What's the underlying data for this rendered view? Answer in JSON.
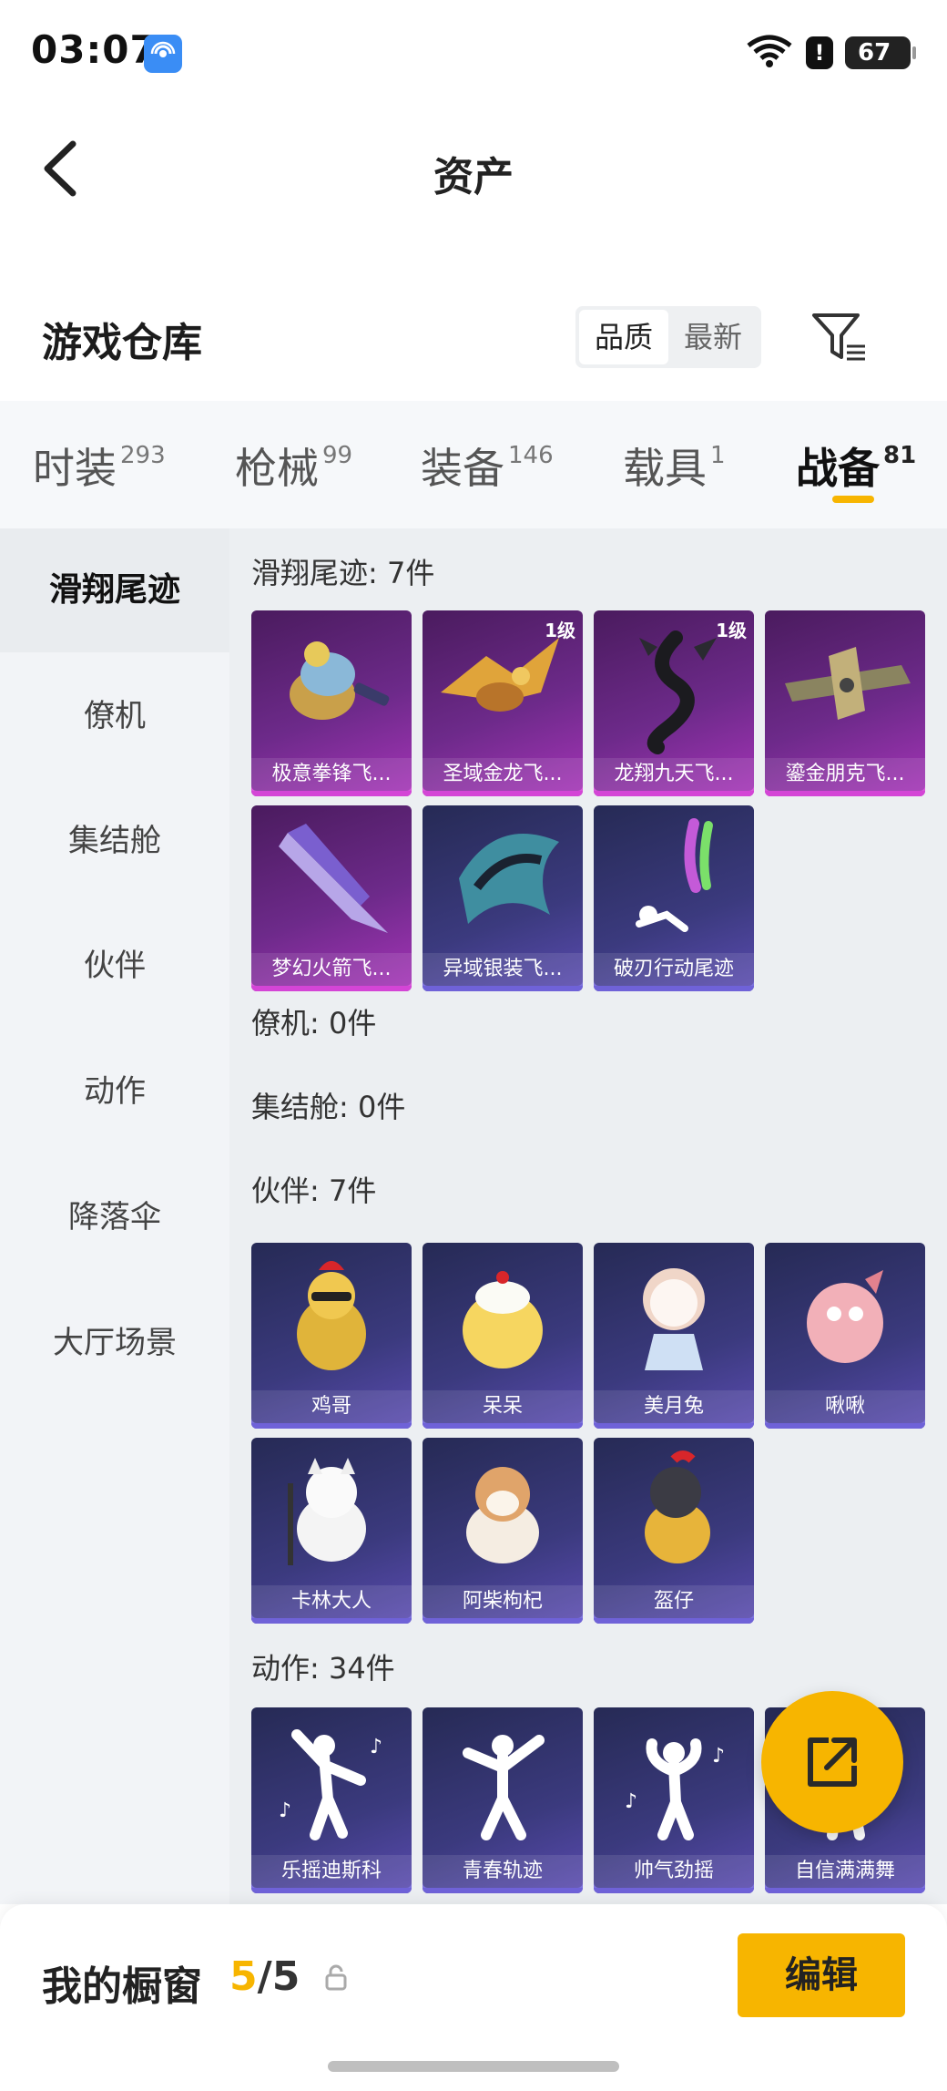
{
  "status_bar": {
    "time": "03:07",
    "alert": "!",
    "battery": "67"
  },
  "header": {
    "title": "资产"
  },
  "warehouse": {
    "title": "游戏仓库",
    "sort_options": [
      "品质",
      "最新"
    ]
  },
  "tabs": [
    {
      "label": "时装",
      "count": "293"
    },
    {
      "label": "枪械",
      "count": "99"
    },
    {
      "label": "装备",
      "count": "146"
    },
    {
      "label": "载具",
      "count": "1"
    },
    {
      "label": "战备",
      "count": "81"
    }
  ],
  "sidebar": {
    "items": [
      "滑翔尾迹",
      "僚机",
      "集结舱",
      "伙伴",
      "动作",
      "降落伞",
      "大厅场景"
    ]
  },
  "sections": {
    "glide": {
      "title": "滑翔尾迹: 7件",
      "items": [
        {
          "name": "极意拳锋飞...",
          "level": ""
        },
        {
          "name": "圣域金龙飞...",
          "level": "1级"
        },
        {
          "name": "龙翔九天飞...",
          "level": "1级"
        },
        {
          "name": "鎏金朋克飞...",
          "level": ""
        },
        {
          "name": "梦幻火箭飞...",
          "level": ""
        },
        {
          "name": "异域银装飞...",
          "level": ""
        },
        {
          "name": "破刃行动尾迹",
          "level": ""
        }
      ]
    },
    "wingman": {
      "title": "僚机: 0件"
    },
    "pod": {
      "title": "集结舱: 0件"
    },
    "partner": {
      "title": "伙伴: 7件",
      "items": [
        "鸡哥",
        "呆呆",
        "美月兔",
        "啾啾",
        "卡林大人",
        "阿柴枸杞",
        "盔仔"
      ]
    },
    "emote": {
      "title": "动作: 34件",
      "items": [
        "乐摇迪斯科",
        "青春轨迹",
        "帅气劲摇",
        "自信满满舞"
      ]
    }
  },
  "bottom_bar": {
    "label": "我的橱窗",
    "current": "5",
    "total": "/5",
    "edit_label": "编辑"
  },
  "colors": {
    "accent": "#f7b500",
    "rare_card": "#a534b7",
    "epic_card": "#5a4bb0"
  }
}
